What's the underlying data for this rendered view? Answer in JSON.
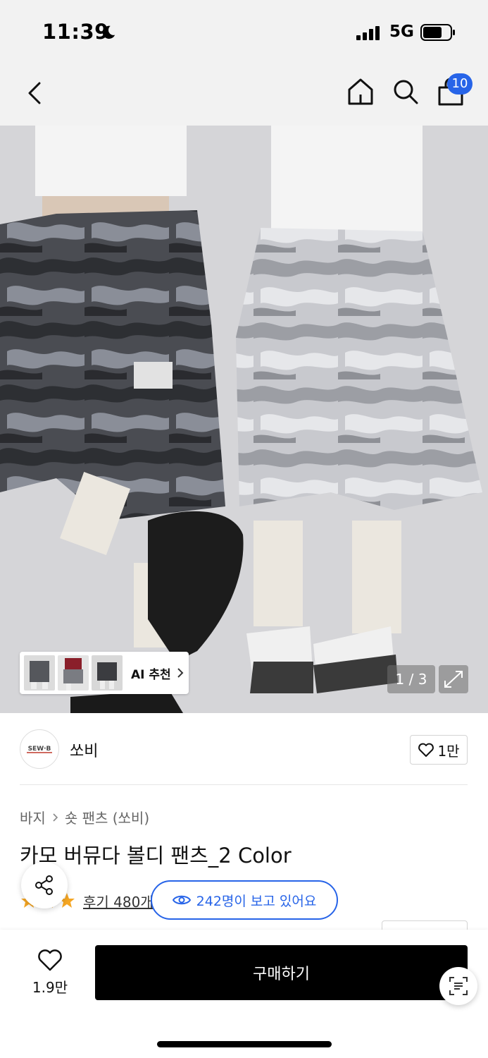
{
  "status_bar": {
    "time": "11:39",
    "network": "5G",
    "icons": [
      "moon-icon",
      "signal-icon",
      "battery-icon"
    ]
  },
  "nav": {
    "icons": [
      "back-icon",
      "home-icon",
      "search-icon",
      "cart-icon"
    ],
    "cart_count": "10",
    "accent_color": "#2764e8"
  },
  "gallery": {
    "ai_recommend_label": "AI 추천",
    "page_indicator": "1 / 3",
    "expand_icon": "expand-icon"
  },
  "brand": {
    "logo_text": "SEW·B",
    "name": "쏘비",
    "like_count": "1만"
  },
  "product": {
    "breadcrumb": [
      "바지",
      "숏 팬츠 (쏘비)"
    ],
    "title": "카모 버뮤다 볼디 팬츠_2 Color",
    "review_link": "후기 480개",
    "viewers_text": "242명이 보고 있어요"
  },
  "bottom_bar": {
    "wish_count": "1.9만",
    "buy_label": "구매하기"
  }
}
